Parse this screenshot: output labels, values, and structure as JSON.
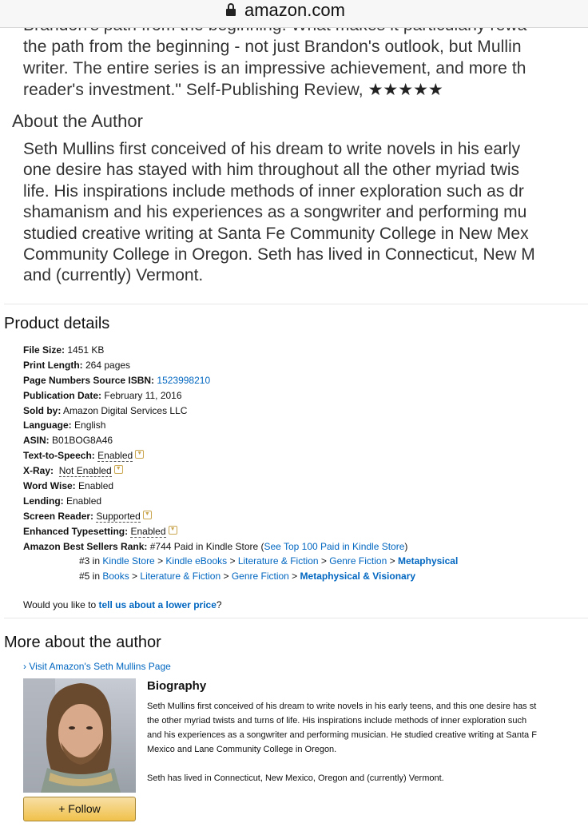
{
  "browser": {
    "domain": "amazon.com"
  },
  "review": {
    "lines": [
      "Brandon's path from the beginning. What makes it particularly rewa",
      "the path from the beginning - not just Brandon's outlook, but Mullin",
      "writer. The entire series is an impressive achievement, and more th",
      "reader's investment.\" Self-Publishing Review, "
    ],
    "stars": "★★★★★"
  },
  "about": {
    "title": "About the Author",
    "lines": [
      "Seth Mullins first conceived of his dream to write novels in his early",
      "one desire has stayed with him throughout all the other myriad twis",
      "life. His inspirations include methods of inner exploration such as dr",
      "shamanism and his experiences as a songwriter and performing mu",
      "studied creative writing at Santa Fe Community College in New Mex",
      "Community College in Oregon. Seth has lived in Connecticut, New M",
      "and (currently) Vermont."
    ]
  },
  "product_details": {
    "title": "Product details",
    "file_size": {
      "label": "File Size:",
      "value": "1451 KB"
    },
    "print_length": {
      "label": "Print Length:",
      "value": "264 pages"
    },
    "isbn": {
      "label": "Page Numbers Source ISBN:",
      "value": "1523998210"
    },
    "pub_date": {
      "label": "Publication Date:",
      "value": "February 11, 2016"
    },
    "sold_by": {
      "label": "Sold by:",
      "value": "Amazon Digital Services LLC"
    },
    "language": {
      "label": "Language:",
      "value": "English"
    },
    "asin": {
      "label": "ASIN:",
      "value": "B01BOG8A46"
    },
    "tts": {
      "label": "Text-to-Speech:",
      "value": "Enabled"
    },
    "xray": {
      "label": "X-Ray:",
      "value": "Not Enabled"
    },
    "word_wise": {
      "label": "Word Wise:",
      "value": "Enabled"
    },
    "lending": {
      "label": "Lending:",
      "value": "Enabled"
    },
    "screen_reader": {
      "label": "Screen Reader:",
      "value": "Supported"
    },
    "typesetting": {
      "label": "Enhanced Typesetting:",
      "value": "Enabled"
    },
    "rank": {
      "label": "Amazon Best Sellers Rank:",
      "value": "#744 Paid in Kindle Store (",
      "link": "See Top 100 Paid in Kindle Store",
      "close": ")",
      "sub1": {
        "pos": "#3 in ",
        "c1": "Kindle Store",
        "c2": "Kindle eBooks",
        "c3": "Literature & Fiction",
        "c4": "Genre Fiction",
        "c5": "Metaphysical"
      },
      "sub2": {
        "pos": "#5 in ",
        "c1": "Books",
        "c2": "Literature & Fiction",
        "c3": "Genre Fiction",
        "c4": "Metaphysical & Visionary"
      },
      "sep": " > "
    },
    "lower_price": {
      "prefix": "Would you like to ",
      "link": "tell us about a lower price",
      "suffix": "?"
    }
  },
  "more_author": {
    "title": "More about the author",
    "visit_link": "› Visit Amazon's Seth Mullins Page",
    "follow_label": "+ Follow",
    "bio_title": "Biography",
    "bio_lines": [
      "Seth Mullins first conceived of his dream to write novels in his early teens, and this one desire has st",
      "the other myriad twists and turns of life. His inspirations include methods of inner exploration such",
      "and his experiences as a songwriter and performing musician. He studied creative writing at Santa F",
      "Mexico and Lane Community College in Oregon."
    ],
    "bio_line2": "Seth has lived in Connecticut, New Mexico, Oregon and (currently) Vermont."
  },
  "colors": {
    "link": "#0066c0",
    "follow_button": "#f0c14b"
  },
  "icons": {
    "lock": "lock-icon",
    "dropdown": "chevron-down-icon"
  }
}
